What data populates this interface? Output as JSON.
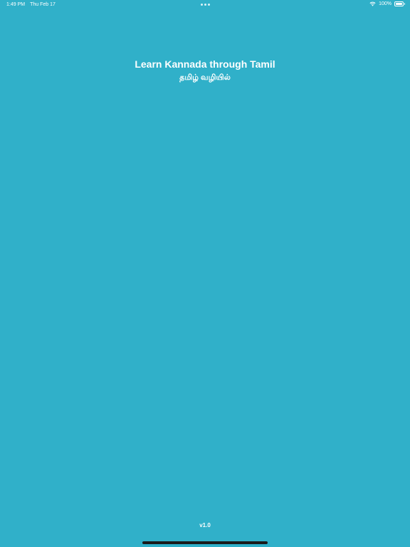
{
  "status_bar": {
    "time": "1:49 PM",
    "date": "Thu Feb 17",
    "battery_percent": "100%",
    "battery_level": 1.0,
    "icons": [
      "wifi-icon",
      "battery-icon"
    ]
  },
  "main": {
    "title": "Learn Kannada through Tamil",
    "subtitle": "தமிழ் வழியில்"
  },
  "footer": {
    "version": "v1.0"
  },
  "colors": {
    "background": "#30b0c9",
    "text": "#ffffff",
    "home_indicator": "#1a1a1a"
  }
}
